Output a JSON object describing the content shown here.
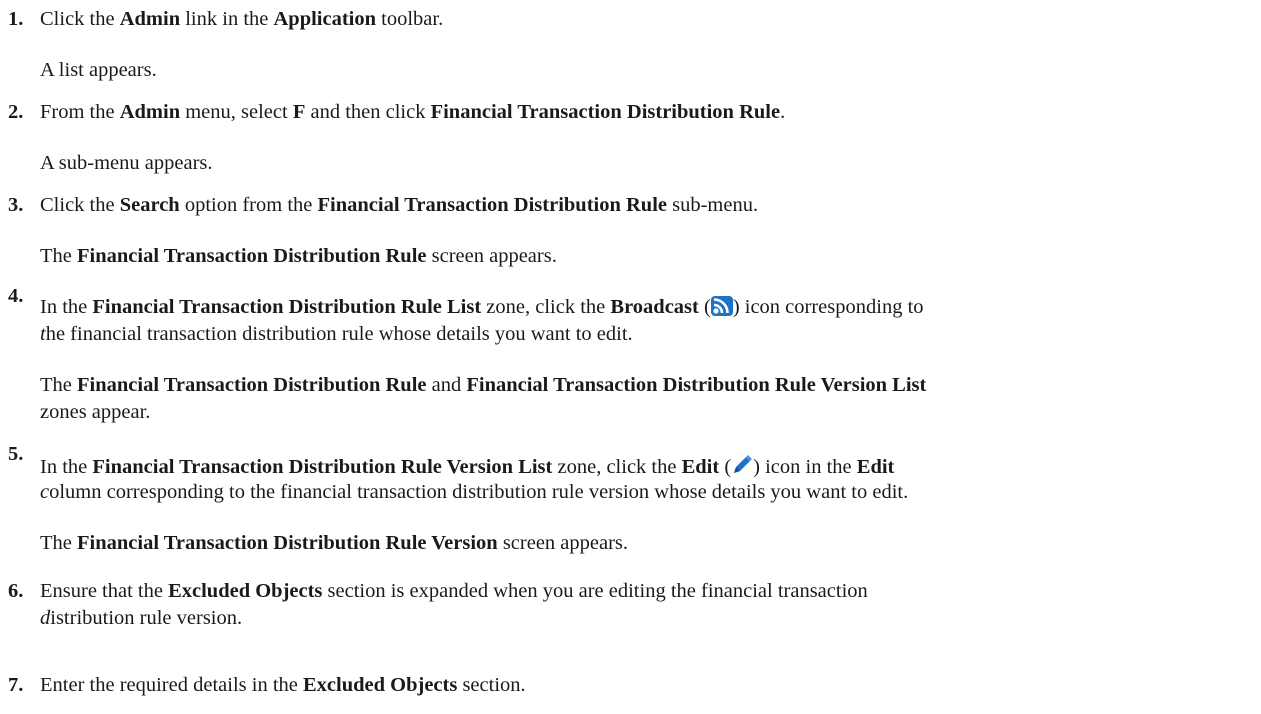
{
  "steps": [
    {
      "number": "1.",
      "parts": [
        "Click the ",
        "Admin",
        " link in the ",
        "Application",
        " toolbar."
      ],
      "result": "A list appears."
    },
    {
      "number": "2.",
      "parts": [
        "From the ",
        "Admin",
        " menu, select ",
        "F",
        " and then click ",
        "Financial Transaction Distribution Rule",
        "."
      ],
      "result": "A sub-menu appears."
    },
    {
      "number": "3.",
      "parts": [
        "Click the ",
        "Search",
        " option from the ",
        "Financial Transaction Distribution Rule",
        " sub-menu."
      ],
      "result_parts": [
        "The ",
        "Financial Transaction Distribution Rule",
        " screen appears."
      ]
    },
    {
      "number": "4.",
      "line1_parts": [
        "In the ",
        "Financial Transaction Distribution Rule List",
        " zone, click the ",
        "Broadcast",
        " (",
        ") icon corresponding to"
      ],
      "line2_parts": [
        "t",
        "he financial transaction distribution rule whose details you want to edit."
      ],
      "icon": "broadcast-icon",
      "result_line1_parts": [
        "The ",
        "Financial Transaction Distribution Rule",
        " and ",
        "Financial Transaction Distribution Rule Version List"
      ],
      "result_line2": "zones appear."
    },
    {
      "number": "5.",
      "line1_parts": [
        "In the ",
        "Financial Transaction Distribution Rule Version List",
        " zone, click the ",
        "Edit",
        " (",
        ") icon in the ",
        "Edit"
      ],
      "line2_parts": [
        "c",
        "olumn corresponding to the financial transaction distribution rule version whose details you want to edit."
      ],
      "icon": "edit-pencil-icon",
      "result_parts": [
        "The ",
        "Financial Transaction Distribution Rule Version",
        " screen appears."
      ]
    },
    {
      "number": "6.",
      "line1_parts": [
        "Ensure that the ",
        "Excluded Objects",
        " section is expanded when you are editing the financial transaction"
      ],
      "line2_parts": [
        "d",
        "istribution rule version."
      ]
    },
    {
      "number": "7.",
      "parts": [
        "Enter the required details in the ",
        "Excluded Objects",
        " section."
      ]
    }
  ],
  "colors": {
    "text": "#1a1a1a",
    "broadcast_icon": "#1e73c8",
    "edit_icon": "#1e73c8"
  }
}
